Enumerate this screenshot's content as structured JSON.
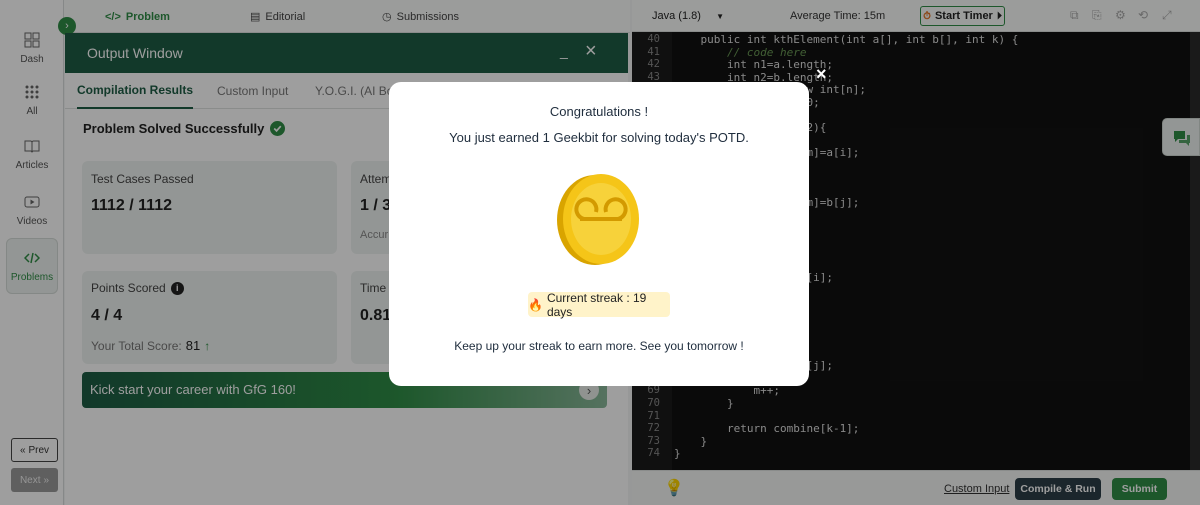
{
  "nav": {
    "items": [
      {
        "label": "Dash",
        "icon": "dashboard-icon"
      },
      {
        "label": "All",
        "icon": "grid-icon"
      },
      {
        "label": "Articles",
        "icon": "book-icon"
      },
      {
        "label": "Videos",
        "icon": "play-icon"
      },
      {
        "label": "Problems",
        "icon": "code-icon"
      }
    ],
    "prev": "Prev",
    "next": "Next"
  },
  "tabs": {
    "problem": "Problem",
    "editorial": "Editorial",
    "submissions": "Submissions"
  },
  "output": {
    "title": "Output Window",
    "subtabs": [
      "Compilation Results",
      "Custom Input",
      "Y.O.G.I. (AI Bot)"
    ],
    "status": "Problem Solved Successfully",
    "cards": {
      "tests_label": "Test Cases Passed",
      "tests_value": "1112 / 1112",
      "attempts_label": "Attem",
      "attempts_value": "1 / 3",
      "accuracy_label": "Accur",
      "points_label": "Points Scored",
      "points_value": "4 / 4",
      "total_label": "Your Total Score:",
      "total_value": "81",
      "time_label": "Time",
      "time_value": "0.81"
    },
    "banner": "Kick start your career with GfG 160!"
  },
  "editor": {
    "language": "Java (1.8)",
    "avg_time": "Average Time: 15m",
    "timer": "Start Timer",
    "lines": [
      {
        "n": "40",
        "code": "    public int kthElement(int a[], int b[], int k) {"
      },
      {
        "n": "41",
        "code": "        // code here"
      },
      {
        "n": "42",
        "code": "        int n1=a.length;"
      },
      {
        "n": "43",
        "code": "        int n2=b.length;"
      },
      {
        "n": "",
        "code": "                  new int[n];"
      },
      {
        "n": "",
        "code": "                  m=0;"
      },
      {
        "n": "",
        "code": ""
      },
      {
        "n": "",
        "code": "                 j<n2){"
      },
      {
        "n": "",
        "code": "                 ]){"
      },
      {
        "n": "",
        "code": "                  e[m]=a[i];"
      },
      {
        "n": "",
        "code": ""
      },
      {
        "n": "",
        "code": ""
      },
      {
        "n": "",
        "code": ""
      },
      {
        "n": "",
        "code": "                  e[m]=b[j];"
      },
      {
        "n": "",
        "code": ""
      },
      {
        "n": "",
        "code": ""
      },
      {
        "n": "",
        "code": ""
      },
      {
        "n": "",
        "code": ""
      },
      {
        "n": "",
        "code": ""
      },
      {
        "n": "",
        "code": "                  =a[i];"
      },
      {
        "n": "",
        "code": ""
      },
      {
        "n": "",
        "code": ""
      },
      {
        "n": "",
        "code": ""
      },
      {
        "n": "",
        "code": ""
      },
      {
        "n": "",
        "code": ""
      },
      {
        "n": "",
        "code": ""
      },
      {
        "n": "",
        "code": "                  =b[j];"
      },
      {
        "n": "68",
        "code": "            j++;"
      },
      {
        "n": "69",
        "code": "            m++;"
      },
      {
        "n": "70",
        "code": "        }"
      },
      {
        "n": "71",
        "code": ""
      },
      {
        "n": "72",
        "code": "        return combine[k-1];"
      },
      {
        "n": "73",
        "code": "    }"
      },
      {
        "n": "74",
        "code": "}"
      }
    ],
    "custom_input": "Custom Input",
    "compile": "Compile & Run",
    "submit": "Submit"
  },
  "modal": {
    "title": "Congratulations !",
    "message": "You just earned 1 Geekbit for solving today's POTD.",
    "streak": "Current streak : 19 days",
    "footer": "Keep up your streak to earn more. See you tomorrow !",
    "close": "×"
  },
  "colors": {
    "brand": "#2f8d46",
    "header": "#1d5c44",
    "submit": "#2f8d46",
    "compile": "#2d3e47"
  }
}
